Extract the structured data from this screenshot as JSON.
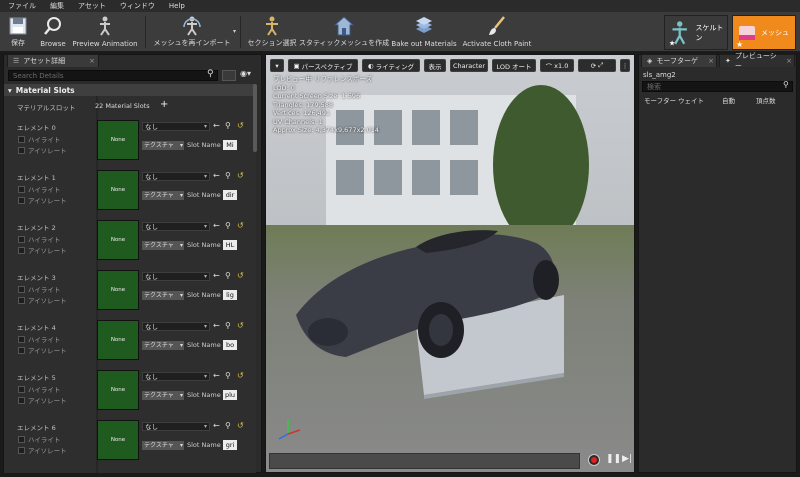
{
  "menu": [
    "ファイル",
    "編集",
    "アセット",
    "ウィンドウ",
    "Help"
  ],
  "toolbar": {
    "buttons": [
      {
        "label": "保存",
        "icon": "save-icon"
      },
      {
        "label": "Browse",
        "icon": "browse-icon"
      },
      {
        "label": "Preview Animation",
        "icon": "preview-animation-icon"
      },
      {
        "label": "メッシュを再インポート",
        "icon": "reimport-icon"
      },
      {
        "label": "セクション選択",
        "icon": "section-select-icon"
      },
      {
        "label": "スタティックメッシュを作成",
        "icon": "make-static-mesh-icon"
      },
      {
        "label": "Bake out Materials",
        "icon": "bake-materials-icon"
      },
      {
        "label": "Activate Cloth Paint",
        "icon": "cloth-paint-icon"
      }
    ],
    "modes": [
      {
        "label": "スケルトン",
        "icon": "skeleton-mode-icon"
      },
      {
        "label": "メッシュ",
        "icon": "mesh-mode-icon",
        "color": "#f08a1c"
      }
    ]
  },
  "left_panel": {
    "tab": "アセット詳細",
    "search_placeholder": "Search Details",
    "section": "Material Slots",
    "slot_label": "マテリアルスロット",
    "slot_count": "22 Material Slots",
    "add_icon": "+",
    "highlight_label": "ハイライト",
    "isolate_label": "アイソレート",
    "material_value": "なし",
    "texture_label": "テクスチャ",
    "slot_name_label": "Slot Name",
    "thumb_label": "None",
    "elements": [
      {
        "name": "エレメント 0",
        "slot": "Mi"
      },
      {
        "name": "エレメント 1",
        "slot": "dir"
      },
      {
        "name": "エレメント 2",
        "slot": "HL"
      },
      {
        "name": "エレメント 3",
        "slot": "lig"
      },
      {
        "name": "エレメント 4",
        "slot": "bo"
      },
      {
        "name": "エレメント 5",
        "slot": "plu"
      },
      {
        "name": "エレメント 6",
        "slot": "gri"
      }
    ]
  },
  "viewport": {
    "perspective": "パースペクティブ",
    "lighting": "ライティング",
    "show": "表示",
    "character": "Character",
    "lod": "LOD オート",
    "speed": "x1.0",
    "stats": [
      "プレビュー中 リファレンスポーズ",
      "LOD: 0",
      "Current Screen Size: 1.596",
      "Triangles: 179,588",
      "Vertices: 126,491",
      "UV Channels: 1",
      "Approx Size: 4,374x9,677x2,014"
    ]
  },
  "right_panel": {
    "tab1": "モーフターゲ",
    "tab2": "プレビューシー",
    "asset_name": "sls_amg2",
    "search_placeholder": "検索",
    "columns": [
      "モーフター",
      "ウェイト",
      "自動",
      "頂点数"
    ]
  }
}
